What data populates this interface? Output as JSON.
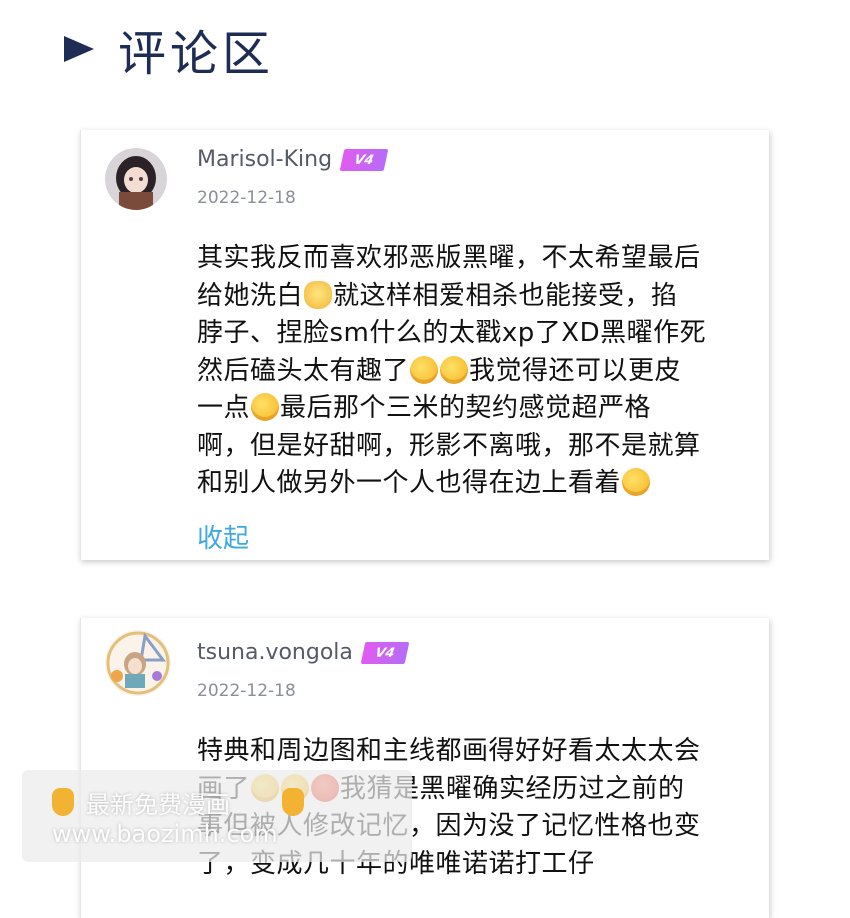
{
  "section": {
    "title": "评论区"
  },
  "comments": [
    {
      "username": "Marisol-King",
      "vip_badge": "V4",
      "date": "2022-12-18",
      "lines": [
        [
          "其实我反而喜欢邪恶版黑曜，不太希望最后"
        ],
        [
          "给她洗白",
          "cat-emoji",
          "就这样相爱相杀也能接受，掐"
        ],
        [
          "脖子、捏脸sm什么的太戳xp了XD黑曜作死"
        ],
        [
          "然后磕头太有趣了",
          "laugh-emoji",
          "laugh-emoji",
          "我觉得还可以更皮"
        ],
        [
          "一点",
          "laugh-emoji",
          "最后那个三米的契约感觉超严格"
        ],
        [
          "啊，但是好甜啊，形影不离哦，那不是就算"
        ],
        [
          "和别人做另外一个人也得在边上看着",
          "laugh-emoji"
        ]
      ],
      "collapse_label": "收起"
    },
    {
      "username": "tsuna.vongola",
      "vip_badge": "V4",
      "date": "2022-12-18",
      "lines": [
        [
          "特典和周边图和主线都画得好好看太太太会"
        ],
        [
          "画了",
          "laugh-emoji",
          "laugh-emoji",
          "angry-emoji",
          "我猜是黑曜确实经历过之前的"
        ],
        [
          "事但被人修改记忆，因为没了记忆性格也变"
        ],
        [
          "了，变成几十年的唯唯诺诺打工仔"
        ]
      ]
    }
  ],
  "watermark": {
    "line1": "最新免费漫画",
    "line2": "www.baozimh.com"
  },
  "colors": {
    "accent_title": "#1f2d55",
    "link": "#3fa7e1",
    "vip": "#d65cf2"
  }
}
